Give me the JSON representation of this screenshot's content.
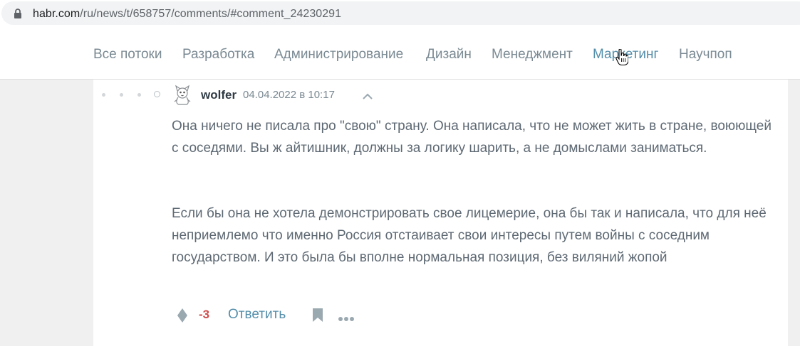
{
  "browser": {
    "url_host": "habr.com",
    "url_path": "/ru/news/t/658757/comments/#comment_24230291"
  },
  "nav": {
    "items": [
      {
        "label": "Все потоки"
      },
      {
        "label": "Разработка"
      },
      {
        "label": "Администрирование"
      },
      {
        "label": "Дизайн"
      },
      {
        "label": "Менеджмент"
      },
      {
        "label": "Маркетинг"
      },
      {
        "label": "Научпоп"
      }
    ],
    "hovered_item": "Маркетинг"
  },
  "comment": {
    "author": "wolfer",
    "date": "04.04.2022 в 10:17",
    "paragraphs": [
      "Она ничего не писала про \"свою\" страну. Она написала, что не может жить в стране, воюющей с соседями. Вы ж айтишник, должны за логику шарить, а не домыслами заниматься.",
      "Если бы она не хотела демонстрировать свое лицемерие, она бы так и написала, что для неё неприемлемо что именно Россия отстаивает свои интересы путем войны с соседним государством. И это была бы вполне нормальная позиция, без виляний жопой"
    ],
    "score": "-3",
    "reply_label": "Ответить"
  },
  "colors": {
    "nav_text": "#7b8a93",
    "nav_hover": "#548eaa",
    "body_text": "#5e6973",
    "negative_score": "#d04e4e",
    "link": "#548eaa"
  },
  "icons": [
    "lock-icon",
    "avatar",
    "collapse-arrow-icon",
    "vote-icon",
    "bookmark-icon",
    "more-icon",
    "cursor-hand-icon"
  ]
}
